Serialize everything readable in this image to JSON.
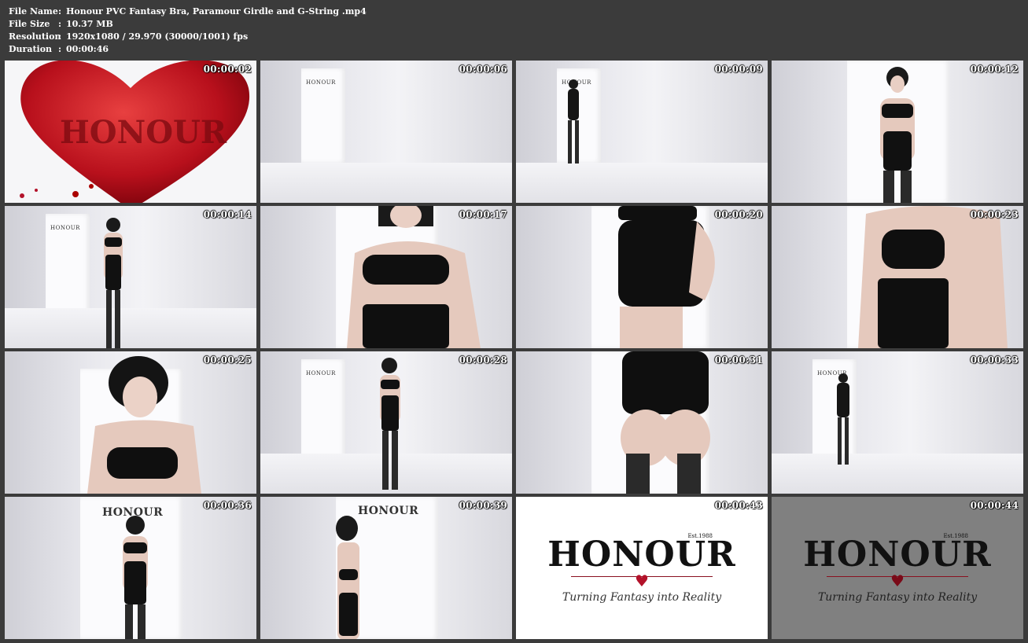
{
  "info": {
    "file_name_label": "File Name",
    "file_name_value": "Honour PVC Fantasy Bra, Paramour Girdle and G-String .mp4",
    "file_size_label": "File Size",
    "file_size_value": "10.37 MB",
    "resolution_label": "Resolution",
    "resolution_value": "1920x1080 / 29.970 (30000/1001) fps",
    "duration_label": "Duration",
    "duration_value": "00:00:46",
    "separator": ":"
  },
  "brand": {
    "word": "HONOUR",
    "est": "Est.1988",
    "tagline": "Turning Fantasy into Reality",
    "door_word": "HONOUR",
    "heart_color": "#b3122a"
  },
  "thumbs": [
    {
      "ts": "00:00:02",
      "scene": "heart"
    },
    {
      "ts": "00:00:06",
      "scene": "room"
    },
    {
      "ts": "00:00:09",
      "scene": "room"
    },
    {
      "ts": "00:00:12",
      "scene": "room"
    },
    {
      "ts": "00:00:14",
      "scene": "room"
    },
    {
      "ts": "00:00:17",
      "scene": "room"
    },
    {
      "ts": "00:00:20",
      "scene": "room"
    },
    {
      "ts": "00:00:23",
      "scene": "room"
    },
    {
      "ts": "00:00:25",
      "scene": "room"
    },
    {
      "ts": "00:00:28",
      "scene": "room"
    },
    {
      "ts": "00:00:31",
      "scene": "room"
    },
    {
      "ts": "00:00:33",
      "scene": "room"
    },
    {
      "ts": "00:00:36",
      "scene": "room"
    },
    {
      "ts": "00:00:39",
      "scene": "room"
    },
    {
      "ts": "00:00:43",
      "scene": "logo-white"
    },
    {
      "ts": "00:00:44",
      "scene": "logo-grey"
    }
  ]
}
